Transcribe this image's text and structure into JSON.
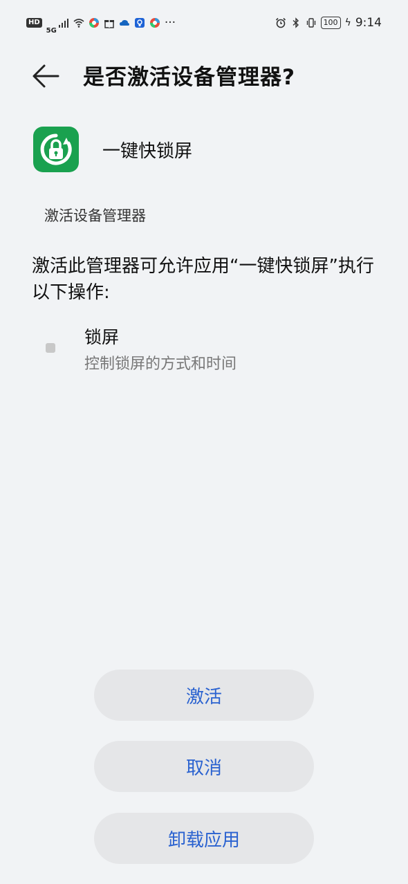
{
  "status_bar": {
    "hd_badge": "HD",
    "network": "5G",
    "more": "···",
    "battery": "100",
    "time": "9:14",
    "icons": [
      "signal-icon",
      "wifi-icon",
      "app-notification-icon",
      "gift-icon",
      "cloud-icon",
      "shield-icon",
      "alarm-icon",
      "bluetooth-icon",
      "vibrate-icon"
    ]
  },
  "header": {
    "title": "是否激活设备管理器?"
  },
  "app": {
    "name": "一键快锁屏",
    "icon_color": "#1aa14f"
  },
  "section_label": "激活设备管理器",
  "description": "激活此管理器可允许应用“一键快锁屏”执行以下操作:",
  "permission": {
    "title": "锁屏",
    "desc": "控制锁屏的方式和时间"
  },
  "buttons": {
    "activate": "激活",
    "cancel": "取消",
    "uninstall": "卸载应用"
  },
  "colors": {
    "accent": "#2a62d0",
    "background": "#f1f3f5",
    "button_bg": "#e5e6e8"
  }
}
